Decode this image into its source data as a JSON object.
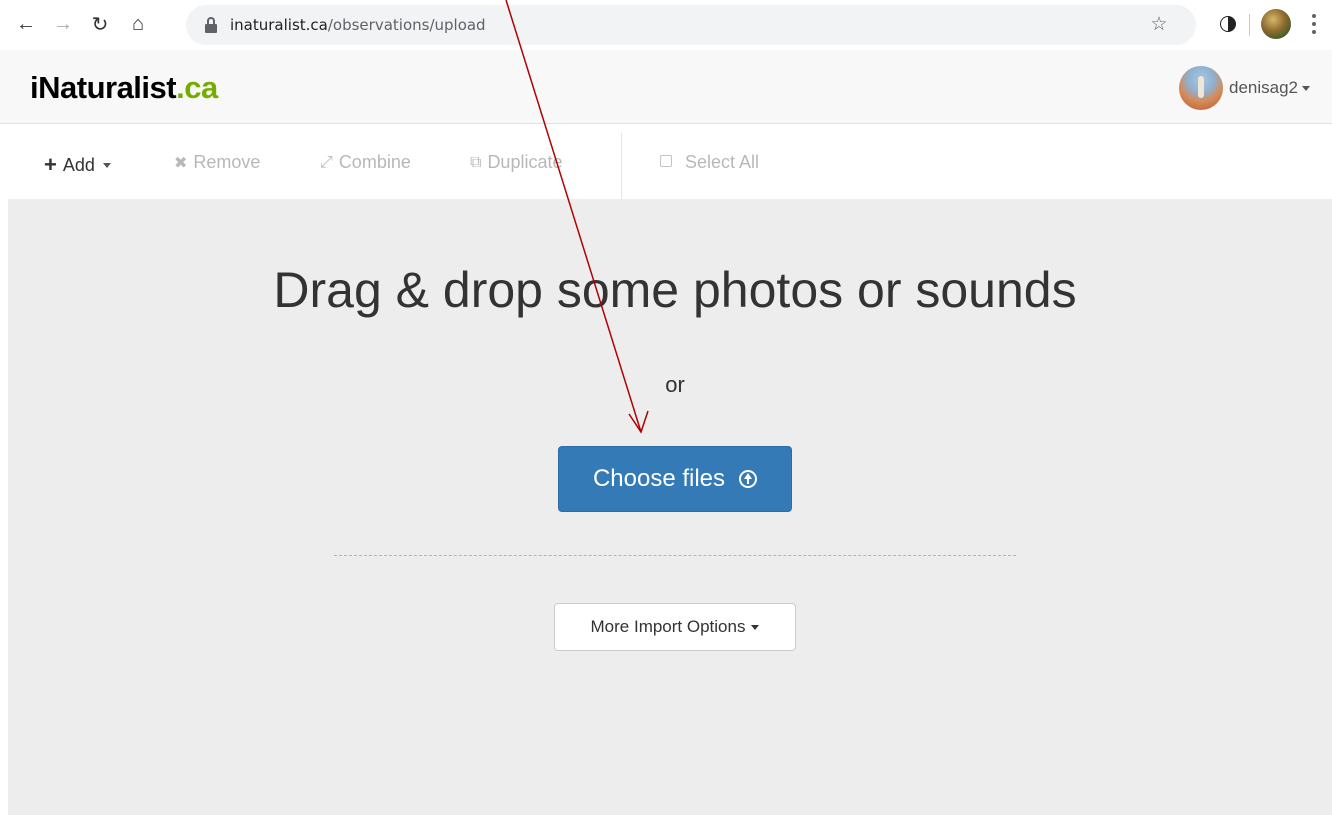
{
  "browser": {
    "back_icon": "back-arrow-icon",
    "forward_icon": "forward-arrow-icon",
    "reload_icon": "reload-icon",
    "home_icon": "home-icon",
    "url_domain": "inaturalist.ca",
    "url_path": "/observations/upload",
    "bookmark_icon": "star-icon",
    "menu_icon": "kebab-menu-icon"
  },
  "header": {
    "logo_brand": "iNaturalist",
    "logo_tld": ".ca",
    "username": "denisag2"
  },
  "toolbar": {
    "add_label": "Add",
    "remove_label": "Remove",
    "combine_label": "Combine",
    "duplicate_label": "Duplicate",
    "select_all_label": "Select All"
  },
  "dropzone": {
    "title": "Drag & drop some photos or sounds",
    "or_text": "or",
    "choose_files_label": "Choose files",
    "more_import_label": "More Import Options"
  },
  "colors": {
    "primary_button": "#337ab7",
    "logo_accent": "#74ac00",
    "annotation_arrow": "#b00000",
    "dropzone_bg": "#ededed"
  }
}
